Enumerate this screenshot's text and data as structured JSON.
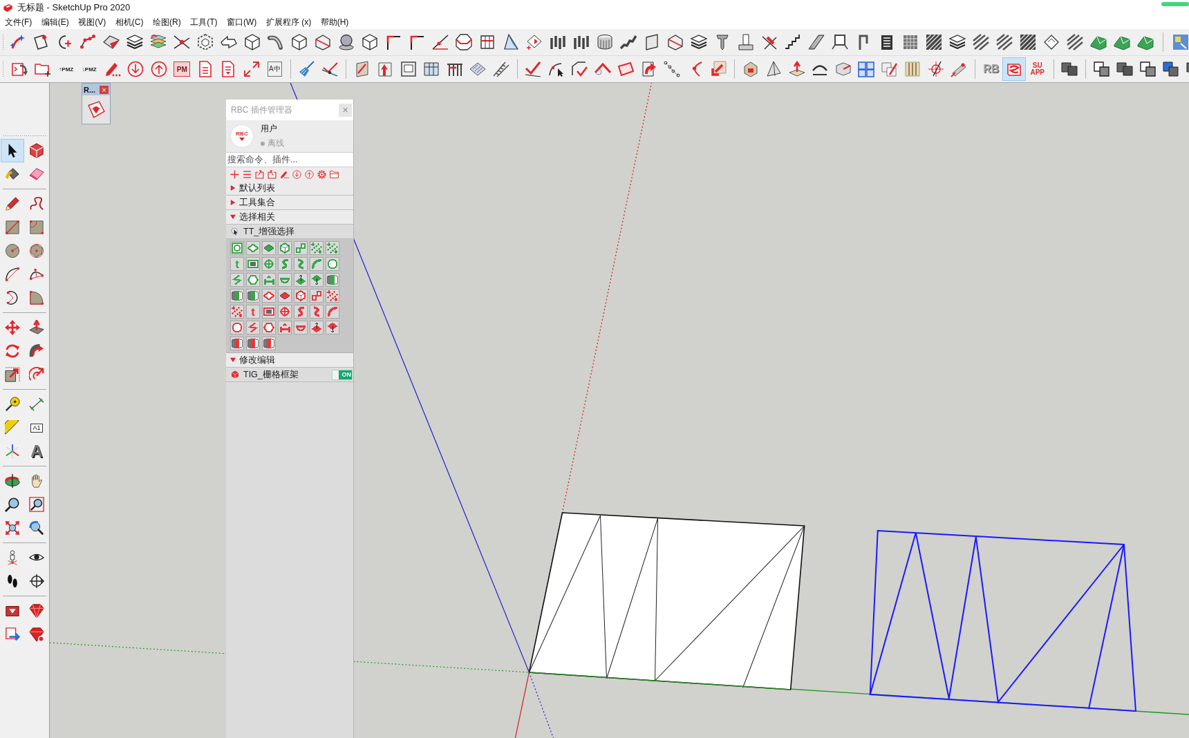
{
  "window": {
    "title": "无标题 - SketchUp Pro 2020"
  },
  "menu": [
    "文件(F)",
    "编辑(E)",
    "视图(V)",
    "相机(C)",
    "绘图(R)",
    "工具(T)",
    "窗口(W)",
    "扩展程序 (x)",
    "帮助(H)"
  ],
  "toolbar_row_2": {
    "tools": [
      {
        "selected": false
      },
      {
        "selected": false
      },
      {
        "selected": false,
        "label": "↑PMZ"
      },
      {
        "selected": false,
        "label": "↓PMZ"
      },
      {
        "selected": false
      },
      {
        "selected": false
      },
      {
        "selected": false
      },
      {
        "selected": false,
        "label": "PM"
      },
      {
        "selected": false
      },
      {
        "selected": false
      },
      {
        "selected": false
      },
      {
        "selected": false,
        "label": "A中"
      },
      {
        "selected": false
      },
      {
        "selected": false
      },
      {
        "selected": false
      },
      {
        "selected": false
      },
      {
        "selected": false
      },
      {
        "selected": false
      },
      {
        "selected": false
      },
      {
        "selected": false
      },
      {
        "selected": false
      },
      {
        "selected": false
      },
      {
        "selected": false
      },
      {
        "selected": false
      },
      {
        "selected": false
      },
      {
        "selected": false
      },
      {
        "selected": false
      },
      {
        "selected": false
      },
      {
        "selected": false
      },
      {
        "selected": false
      },
      {
        "selected": false
      },
      {
        "selected": false
      },
      {
        "selected": false
      },
      {
        "selected": false
      },
      {
        "selected": false
      },
      {
        "selected": false
      },
      {
        "selected": false
      },
      {
        "selected": false
      },
      {
        "selected": false
      },
      {
        "selected": false
      },
      {
        "selected": false,
        "label": "RB"
      },
      {
        "selected": true
      },
      {
        "selected": false,
        "label": "SU APP"
      },
      {
        "selected": false
      },
      {
        "selected": false
      },
      {
        "selected": false
      },
      {
        "selected": false
      },
      {
        "selected": false
      },
      {
        "selected": false
      }
    ]
  },
  "left_toolbar": {
    "tools": [
      {
        "selected": true
      },
      {
        "selected": false
      },
      {
        "selected": false
      },
      {
        "selected": false
      },
      {
        "selected": false
      },
      {
        "selected": false
      },
      {
        "selected": false
      },
      {
        "selected": false
      },
      {
        "selected": false
      },
      {
        "selected": false
      },
      {
        "selected": false
      },
      {
        "selected": false
      },
      {
        "selected": false
      },
      {
        "selected": false
      },
      {
        "selected": false
      },
      {
        "selected": false
      },
      {
        "selected": false
      },
      {
        "selected": false
      },
      {
        "selected": false
      },
      {
        "selected": false
      },
      {
        "selected": false
      },
      {
        "selected": false
      },
      {
        "selected": false
      },
      {
        "selected": false,
        "label": "A1"
      },
      {
        "selected": false
      },
      {
        "selected": false,
        "label": "A"
      },
      {
        "selected": false
      },
      {
        "selected": false
      },
      {
        "selected": false
      },
      {
        "selected": false
      },
      {
        "selected": false
      },
      {
        "selected": false
      },
      {
        "selected": false
      },
      {
        "selected": false
      },
      {
        "selected": false
      },
      {
        "selected": false
      },
      {
        "selected": false
      },
      {
        "selected": false
      },
      {
        "selected": false
      },
      {
        "selected": false
      }
    ]
  },
  "mini_window": {
    "title": "R...",
    "close": "×"
  },
  "plugin_panel": {
    "title": "RBC 插件管理器",
    "close": "×",
    "logo": "RBC",
    "user": {
      "name": "用户",
      "status": "离线",
      "online": false
    },
    "search": {
      "placeholder": "搜索命令、插件..."
    },
    "sections": [
      {
        "label": "默认列表",
        "expanded": false
      },
      {
        "label": "工具集合",
        "expanded": false
      },
      {
        "label": "选择相关",
        "expanded": true,
        "children": [
          {
            "label": "TT_增强选择",
            "kind": "grid",
            "tools": [
              {
                "color": "#3aa64a"
              },
              {
                "color": "#3aa64a"
              },
              {
                "color": "#3aa64a"
              },
              {
                "color": "#3aa64a"
              },
              {
                "color": "#3aa64a"
              },
              {
                "color": "#3aa64a"
              },
              {
                "color": "#3aa64a"
              },
              {
                "color": "#3aa64a",
                "label": "t"
              },
              {
                "color": "#3aa64a"
              },
              {
                "color": "#3aa64a"
              },
              {
                "color": "#3aa64a"
              },
              {
                "color": "#3aa64a"
              },
              {
                "color": "#3aa64a"
              },
              {
                "color": "#3aa64a"
              },
              {
                "color": "#3aa64a"
              },
              {
                "color": "#3aa64a"
              },
              {
                "color": "#3aa64a"
              },
              {
                "color": "#3aa64a"
              },
              {
                "color": "#3aa64a"
              },
              {
                "color": "#3aa64a"
              },
              {
                "color": "#3aa64a"
              },
              {
                "color": "#3aa64a"
              },
              {
                "color": "#3aa64a"
              },
              {
                "color": "#e8383d"
              },
              {
                "color": "#e8383d"
              },
              {
                "color": "#e8383d"
              },
              {
                "color": "#e8383d"
              },
              {
                "color": "#e8383d"
              },
              {
                "color": "#e8383d"
              },
              {
                "color": "#e8383d",
                "label": "t"
              },
              {
                "color": "#e8383d"
              },
              {
                "color": "#e8383d"
              },
              {
                "color": "#e8383d"
              },
              {
                "color": "#e8383d"
              },
              {
                "color": "#e8383d"
              },
              {
                "color": "#e8383d"
              },
              {
                "color": "#e8383d"
              },
              {
                "color": "#e8383d"
              },
              {
                "color": "#e8383d"
              },
              {
                "color": "#e8383d"
              },
              {
                "color": "#e8383d"
              },
              {
                "color": "#e8383d"
              },
              {
                "color": "#e8383d"
              },
              {
                "color": "#e8383d"
              },
              {
                "color": "#e8383d"
              }
            ]
          }
        ]
      },
      {
        "label": "修改编辑",
        "expanded": true,
        "children": [
          {
            "label": "TIG_栅格框架",
            "kind": "toggle",
            "toggle": {
              "on": true,
              "label": "ON"
            }
          }
        ]
      }
    ]
  }
}
